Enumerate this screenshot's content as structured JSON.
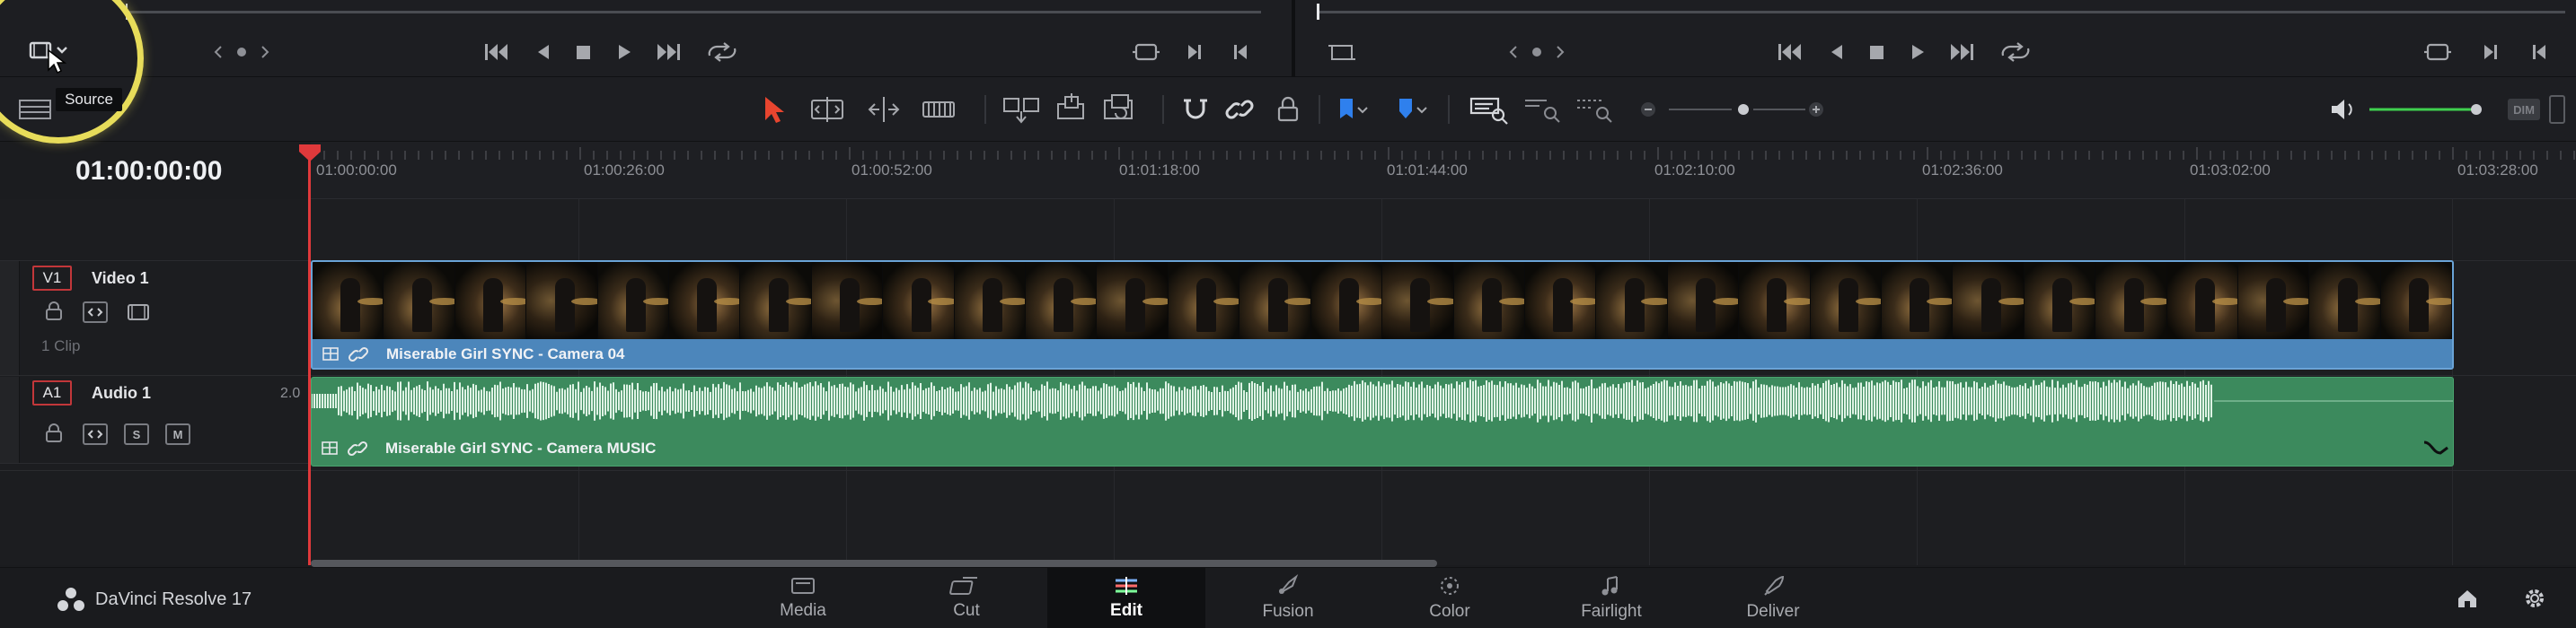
{
  "timeline": {
    "timecode": "01:00:00:00",
    "ruler_labels": [
      "01:00:00:00",
      "01:00:26:00",
      "01:00:52:00",
      "01:01:18:00",
      "01:01:44:00",
      "01:02:10:00",
      "01:02:36:00",
      "01:03:02:00",
      "01:03:28:00"
    ]
  },
  "tooltip": {
    "text": "Source"
  },
  "toolbar": {
    "dim_label": "DIM"
  },
  "tracks": {
    "video": {
      "badge": "V1",
      "name": "Video 1",
      "clip_count": "1 Clip",
      "clip_title": "Miserable Girl SYNC - Camera 04"
    },
    "audio": {
      "badge": "A1",
      "name": "Audio 1",
      "channels": "2.0",
      "solo_label": "S",
      "mute_label": "M",
      "clip_title": "Miserable Girl SYNC - Camera MUSIC"
    }
  },
  "app": {
    "name": "DaVinci Resolve 17"
  },
  "pages": [
    {
      "label": "Media",
      "icon": "media-icon"
    },
    {
      "label": "Cut",
      "icon": "cut-icon"
    },
    {
      "label": "Edit",
      "icon": "edit-icon",
      "active": true
    },
    {
      "label": "Fusion",
      "icon": "fusion-icon"
    },
    {
      "label": "Color",
      "icon": "color-icon"
    },
    {
      "label": "Fairlight",
      "icon": "fairlight-icon"
    },
    {
      "label": "Deliver",
      "icon": "deliver-icon"
    }
  ],
  "colors": {
    "playhead": "#e0393b",
    "video_clip": "#4c86bb",
    "audio_clip": "#3c8a5d",
    "volume": "#3fd04f",
    "selection_tool": "#e8452f",
    "flag": "#2f80ed",
    "highlight_ring": "#e7dc5a"
  }
}
